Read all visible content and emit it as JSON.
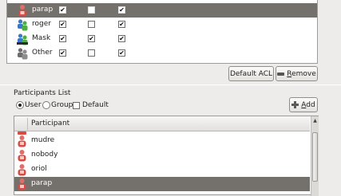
{
  "acl": {
    "rows": [
      {
        "name": "parap",
        "icon": "user-icon",
        "checks": [
          true,
          false,
          true
        ],
        "selected": true
      },
      {
        "name": "roger",
        "icon": "group-icon",
        "checks": [
          true,
          false,
          true
        ],
        "selected": false
      },
      {
        "name": "Mask",
        "icon": "mask-icon",
        "checks": [
          true,
          true,
          true
        ],
        "selected": false
      },
      {
        "name": "Other",
        "icon": "other-icon",
        "checks": [
          true,
          false,
          true
        ],
        "selected": false
      }
    ],
    "default_acl_label": "Default ACL",
    "remove_label_pre": "",
    "remove_label_u": "R",
    "remove_label_post": "emove"
  },
  "participants": {
    "title": "Participants List",
    "filters": {
      "user": "User",
      "group": "Group",
      "default": "Default",
      "selected": "user"
    },
    "add_label_u": "A",
    "add_label_post": "dd",
    "column_header": "Participant",
    "rows": [
      {
        "name": "mudre",
        "selected": false
      },
      {
        "name": "nobody",
        "selected": false
      },
      {
        "name": "oriol",
        "selected": false
      },
      {
        "name": "parap",
        "selected": true
      }
    ]
  },
  "colors": {
    "selection": "#74716d",
    "user_icon": "#d94a43"
  }
}
